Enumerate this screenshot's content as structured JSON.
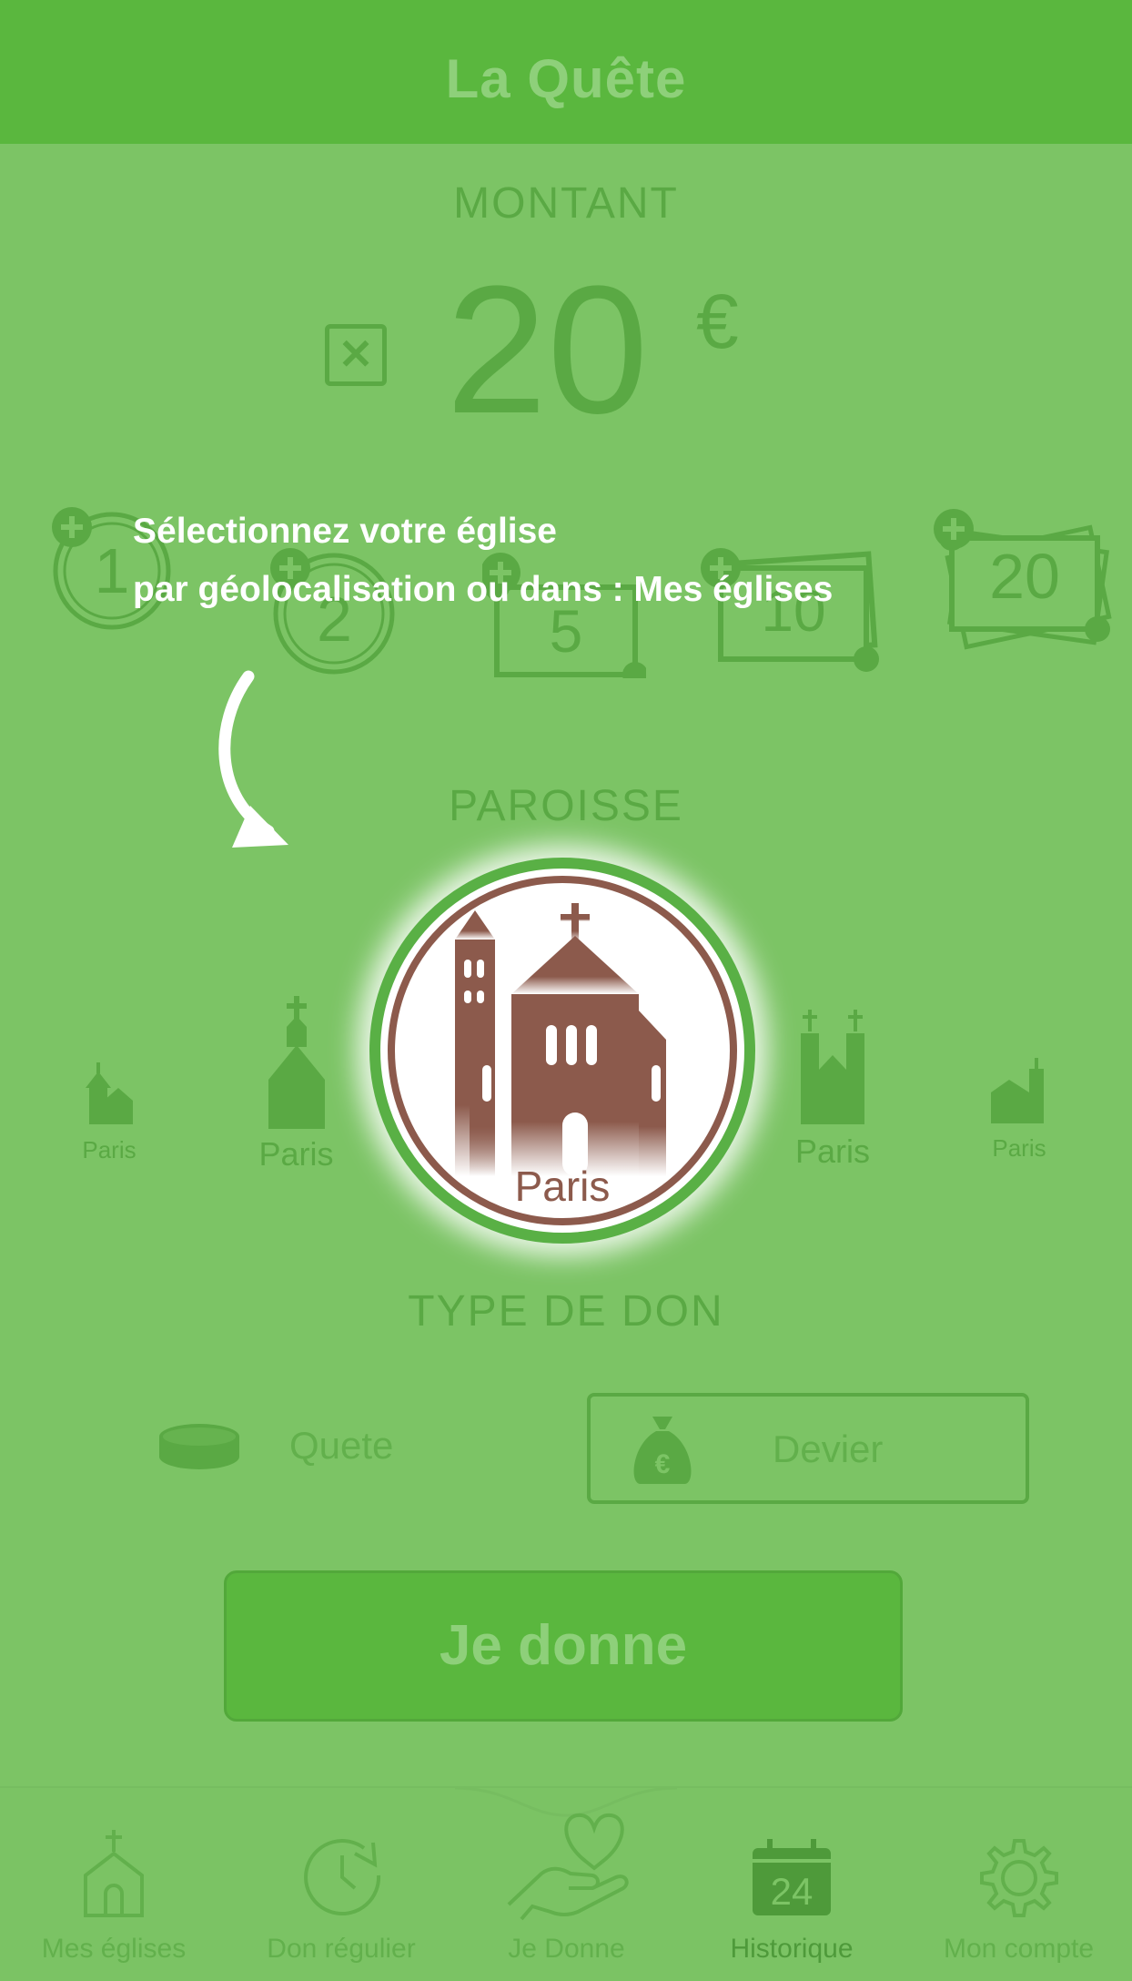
{
  "app": {
    "title": "La Quête"
  },
  "amount_section": {
    "label": "MONTANT",
    "value": "20",
    "currency": "€",
    "clear_icon": "close-square-icon"
  },
  "quick_amounts": [
    {
      "label": "1",
      "icon": "coin-icon"
    },
    {
      "label": "2",
      "icon": "coin-icon"
    },
    {
      "label": "5",
      "icon": "banknote-icon"
    },
    {
      "label": "10",
      "icon": "banknote-icon"
    },
    {
      "label": "20",
      "icon": "banknote-stack-icon"
    }
  ],
  "tooltip": {
    "line1": "Sélectionnez votre église",
    "line2": "par géolocalisation ou dans : Mes églises"
  },
  "parish_section": {
    "label": "PAROISSE",
    "churches": [
      {
        "label": "Paris",
        "icon": "small-church-icon"
      },
      {
        "label": "Paris",
        "icon": "chapel-icon"
      },
      {
        "label": "Paris",
        "icon": "basilica-icon",
        "selected": true
      },
      {
        "label": "Paris",
        "icon": "cathedral-icon"
      },
      {
        "label": "Paris",
        "icon": "long-church-icon"
      }
    ]
  },
  "donation_type": {
    "label": "TYPE DE DON",
    "options": [
      {
        "label": "Quete",
        "icon": "coin-icon",
        "selected": false
      },
      {
        "label": "Devier",
        "icon": "money-bag-euro-icon",
        "selected": true
      }
    ]
  },
  "give_button": {
    "label": "Je donne"
  },
  "tabs": [
    {
      "label": "Mes églises",
      "icon": "church-icon",
      "active": false
    },
    {
      "label": "Don régulier",
      "icon": "clock-refresh-icon",
      "active": false
    },
    {
      "label": "Je Donne",
      "icon": "hand-heart-icon",
      "active": false
    },
    {
      "label": "Historique",
      "icon": "calendar-icon",
      "calendar_day": "24",
      "active": true
    },
    {
      "label": "Mon compte",
      "icon": "gear-icon",
      "active": false
    }
  ],
  "colors": {
    "header": "#5ab73e",
    "overlay_green": "#7cc465",
    "church_brown": "#8c5a4c",
    "ring_green": "#59b045"
  }
}
